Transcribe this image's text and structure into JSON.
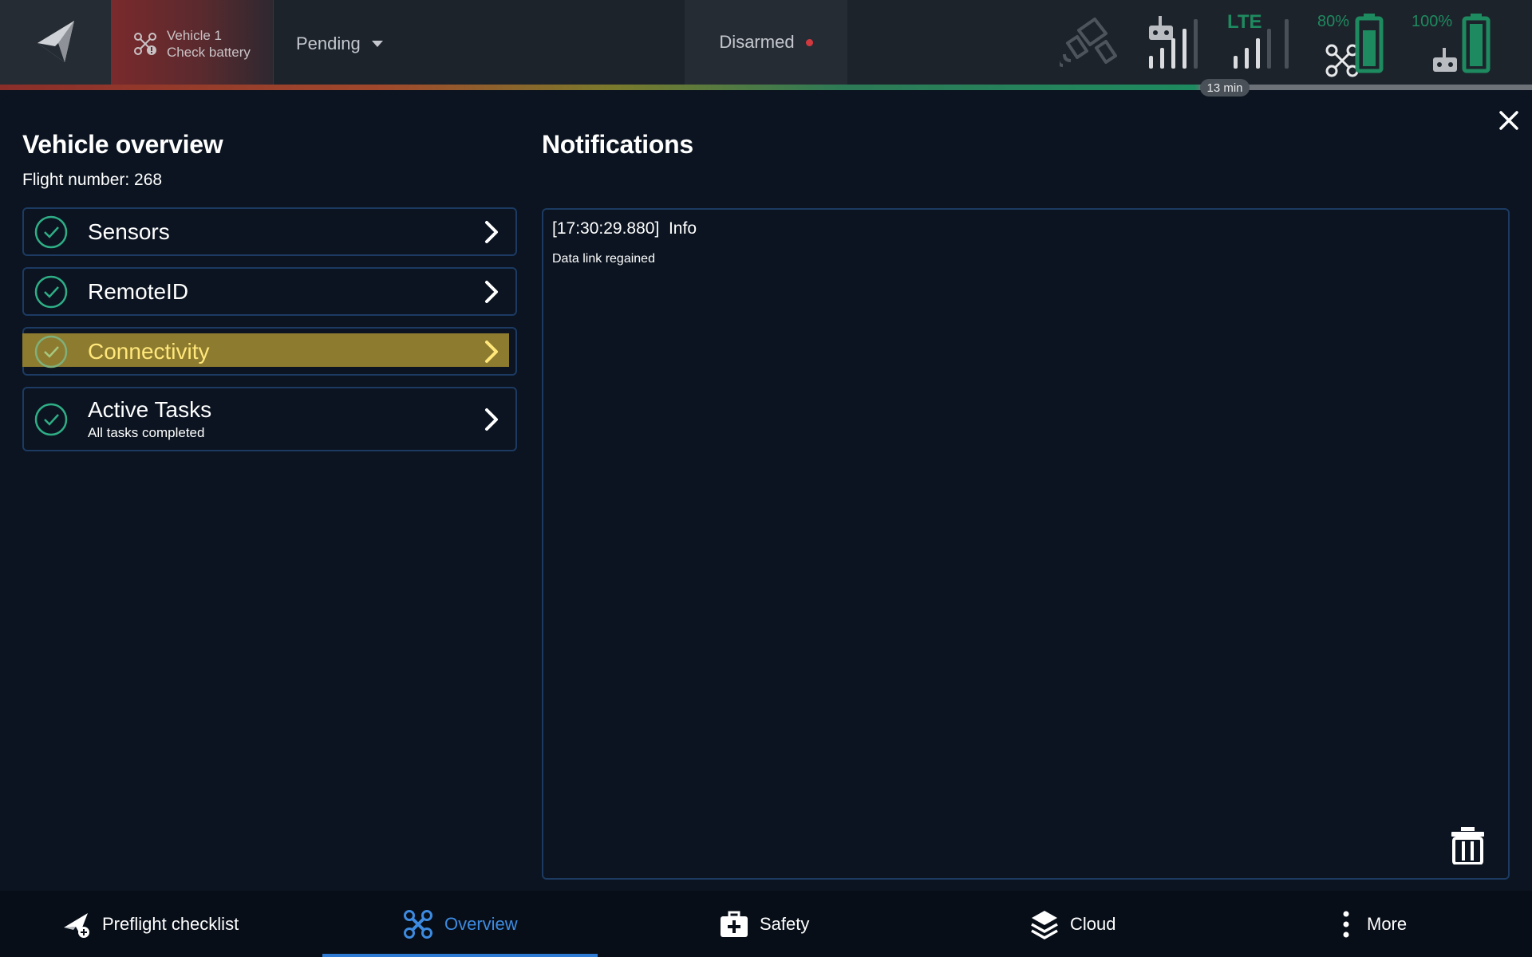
{
  "topbar": {
    "vehicle_name": "Vehicle 1",
    "vehicle_warning": "Check battery",
    "flight_state": "Pending",
    "arm_state": "Disarmed",
    "link_type": "LTE",
    "vehicle_battery": "80%",
    "controller_battery": "100%",
    "time_remaining": "13 min",
    "colors": {
      "good": "#1e8a5f",
      "alert": "#d1393f"
    }
  },
  "overview": {
    "title": "Vehicle overview",
    "flight_number": "Flight number: 268",
    "items": [
      {
        "label": "Sensors",
        "status": "ok"
      },
      {
        "label": "RemoteID",
        "status": "ok"
      },
      {
        "label": "Connectivity",
        "status": "ok",
        "highlighted": true
      },
      {
        "label": "Active Tasks",
        "sublabel": "All tasks completed",
        "status": "ok"
      }
    ]
  },
  "notifications": {
    "title": "Notifications",
    "entries": [
      {
        "time": "[17:30:29.880]",
        "level": "Info",
        "message": "Data link regained"
      }
    ]
  },
  "bottom_nav": {
    "items": [
      {
        "label": "Preflight checklist",
        "icon": "plane-takeoff-icon"
      },
      {
        "label": "Overview",
        "icon": "drone-icon",
        "active": true
      },
      {
        "label": "Safety",
        "icon": "first-aid-kit-icon"
      },
      {
        "label": "Cloud",
        "icon": "layers-icon"
      },
      {
        "label": "More",
        "icon": "more-vertical-icon"
      }
    ]
  }
}
